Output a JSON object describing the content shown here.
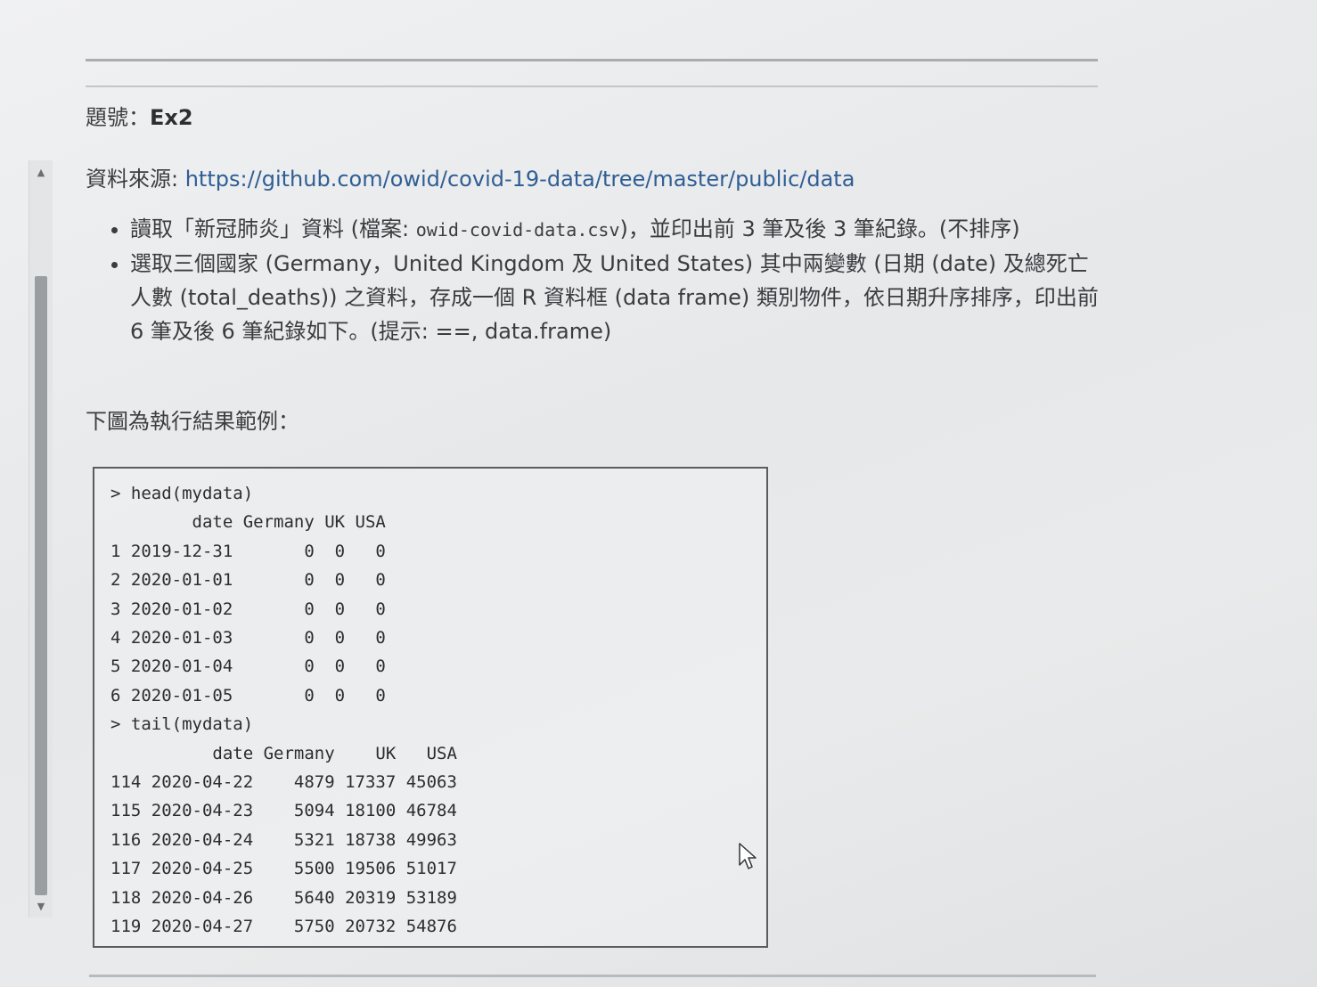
{
  "question": {
    "label": "題號：",
    "id": "Ex2"
  },
  "source": {
    "label": "資料來源: ",
    "url": "https://github.com/owid/covid-19-data/tree/master/public/data"
  },
  "tasks": [
    {
      "pre": "讀取「新冠肺炎」資料 (檔案: ",
      "code": "owid-covid-data.csv",
      "post": ")，並印出前 3 筆及後 3 筆紀錄。(不排序)"
    },
    {
      "text": "選取三個國家 (Germany，United Kingdom 及 United States) 其中兩變數 (日期 (date) 及總死亡人數 (total_deaths)) 之資料，存成一個 R 資料框 (data frame) 類別物件，依日期升序排序，印出前 6 筆及後 6 筆紀錄如下。(提示: ==, data.frame)"
    }
  ],
  "example_label": "下圖為執行結果範例：",
  "console": {
    "head_cmd": "> head(mydata)",
    "head_header": "        date Germany UK USA",
    "head_rows": [
      "1 2019-12-31       0  0   0",
      "2 2020-01-01       0  0   0",
      "3 2020-01-02       0  0   0",
      "4 2020-01-03       0  0   0",
      "5 2020-01-04       0  0   0",
      "6 2020-01-05       0  0   0"
    ],
    "tail_cmd": "> tail(mydata)",
    "tail_header": "          date Germany    UK   USA",
    "tail_rows": [
      "114 2020-04-22    4879 17337 45063",
      "115 2020-04-23    5094 18100 46784",
      "116 2020-04-24    5321 18738 49963",
      "117 2020-04-25    5500 19506 51017",
      "118 2020-04-26    5640 20319 53189",
      "119 2020-04-27    5750 20732 54876"
    ]
  },
  "icons": {
    "scroll_up": "triangle-up-icon",
    "scroll_down": "triangle-down-icon",
    "cursor": "mouse-pointer-icon"
  }
}
